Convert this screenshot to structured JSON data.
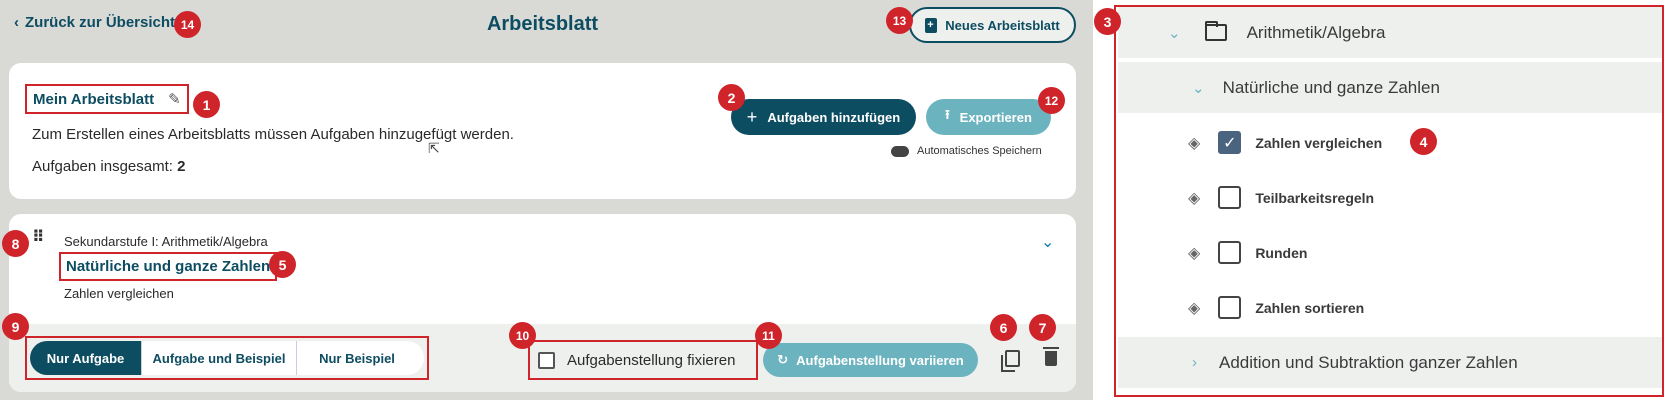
{
  "header": {
    "back_label": "Zurück zur Übersicht",
    "title": "Arbeitsblatt",
    "new_sheet_label": "Neues Arbeitsblatt"
  },
  "worksheet": {
    "name": "Mein Arbeitsblatt",
    "info": "Zum Erstellen eines Arbeitsblatts müssen Aufgaben hinzugefügt werden.",
    "count_label": "Aufgaben insgesamt:",
    "count_value": "2",
    "add_label": "Aufgaben hinzufügen",
    "export_label": "Exportieren",
    "autosave_label": "Automatisches Speichern"
  },
  "task": {
    "category": "Sekundarstufe I: Arithmetik/Algebra",
    "topic": "Natürliche und ganze Zahlen",
    "subtopic": "Zahlen vergleichen",
    "modes": [
      "Nur Aufgabe",
      "Aufgabe und Beispiel",
      "Nur Beispiel"
    ],
    "active_mode": "Nur Aufgabe",
    "fix_label": "Aufgabenstellung fixieren",
    "fix_checked": false,
    "vary_label": "Aufgabenstellung variieren"
  },
  "tree": {
    "folder": "Arithmetik/Algebra",
    "group": "Natürliche und ganze Zahlen",
    "items": [
      {
        "label": "Zahlen vergleichen",
        "checked": true
      },
      {
        "label": "Teilbarkeitsregeln",
        "checked": false
      },
      {
        "label": "Runden",
        "checked": false
      },
      {
        "label": "Zahlen sortieren",
        "checked": false
      }
    ],
    "next_group": "Addition und Subtraktion ganzer Zahlen"
  },
  "badges": [
    "1",
    "2",
    "3",
    "4",
    "5",
    "6",
    "7",
    "8",
    "9",
    "10",
    "11",
    "12",
    "13",
    "14"
  ],
  "colors": {
    "primary": "#0d4d62",
    "secondary": "#6cb3c0",
    "annotation_red": "#d0242b",
    "background": "#d9dad6",
    "checked_box": "#4a6480"
  }
}
